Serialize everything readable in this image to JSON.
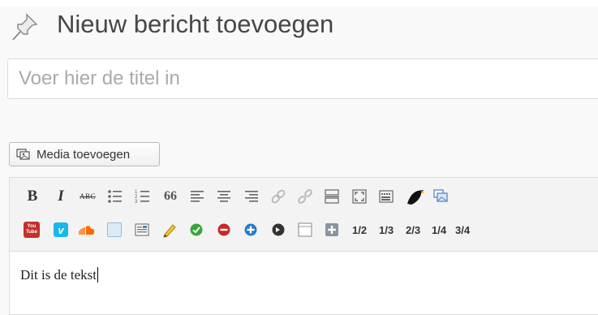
{
  "header": {
    "title": "Nieuw bericht toevoegen"
  },
  "title_field": {
    "placeholder": "Voer hier de titel in",
    "value": ""
  },
  "media_button": {
    "label": "Media toevoegen"
  },
  "toolbar": {
    "row1": [
      "bold",
      "italic",
      "strikethrough",
      "bullet-list",
      "numbered-list",
      "blockquote",
      "align-left",
      "align-center",
      "align-right",
      "insert-link",
      "remove-link",
      "insert-more",
      "fullscreen",
      "show-kitchen-sink",
      "twitter-bird",
      "insert-image"
    ],
    "row2": [
      "youtube",
      "vimeo",
      "soundcloud",
      "box",
      "text-box",
      "highlight",
      "green-check",
      "red-minus",
      "blue-plus",
      "black-arrow",
      "column-box",
      "add-box",
      "1/2",
      "1/3",
      "2/3",
      "1/4",
      "3/4"
    ],
    "bold_label": "B",
    "italic_label": "I",
    "strike_label": "ABC",
    "blockquote_label": "66",
    "youtube_label": "You Tube",
    "vimeo_label": "v",
    "fractions": [
      "1/2",
      "1/3",
      "2/3",
      "1/4",
      "3/4"
    ]
  },
  "editor": {
    "content": "Dit is de tekst"
  },
  "colors": {
    "green": "#3aa53a",
    "red": "#c62828",
    "blue": "#2a7ac8",
    "soundcloud": "#ff6a00",
    "vimeo": "#1ab7ea",
    "youtube": "#c4302b"
  }
}
